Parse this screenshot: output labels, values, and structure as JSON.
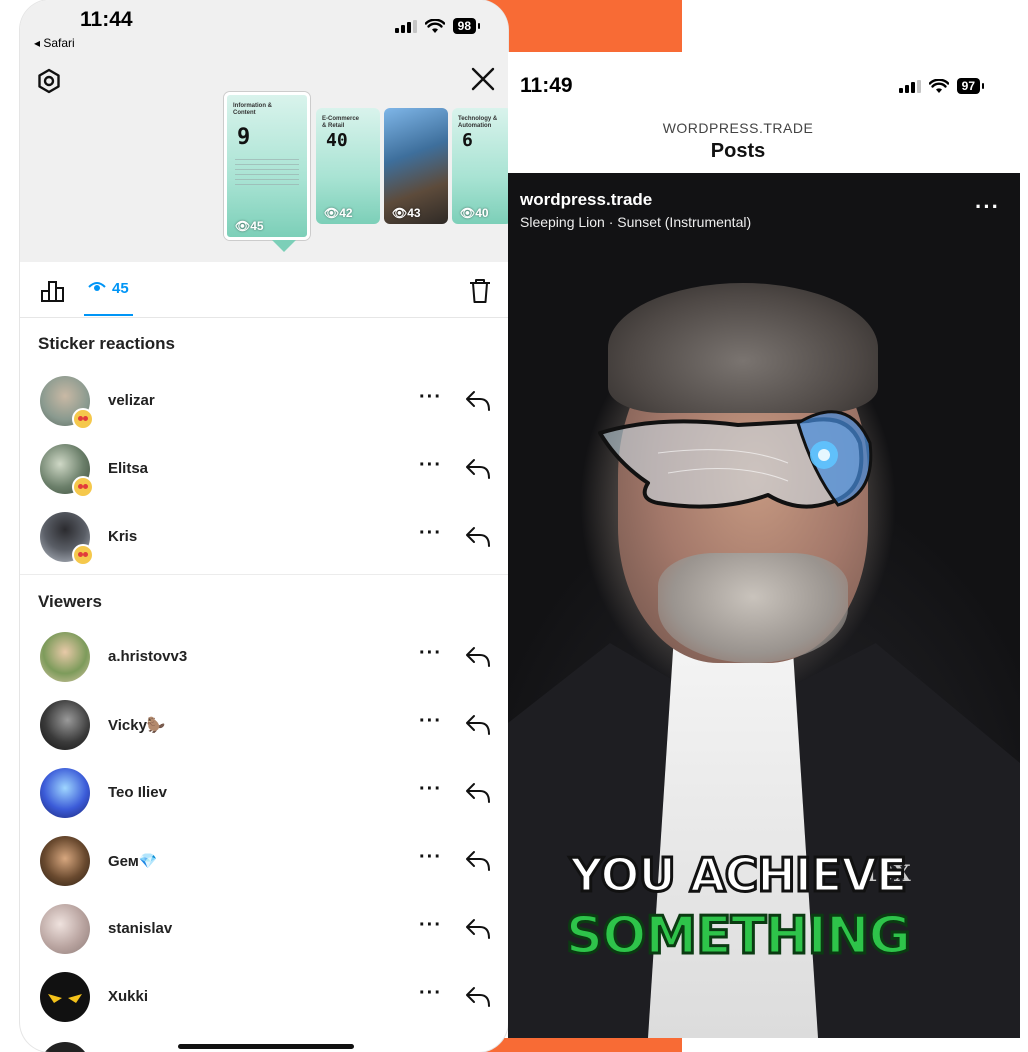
{
  "colors": {
    "accent_blue": "#0095f6",
    "orange": "#f86b35",
    "caption_green": "#2ec44a"
  },
  "left": {
    "status": {
      "time": "11:44",
      "back_app": "◂ Safari",
      "battery": "98"
    },
    "thumbnails": [
      {
        "title": "Information & Content",
        "number": "9",
        "views": "45",
        "selected": true
      },
      {
        "title": "E-Commerce & Retail",
        "number": "40",
        "views": "42"
      },
      {
        "title": "",
        "number": "",
        "views": "43",
        "photo": true
      },
      {
        "title": "Technology & Automation",
        "number": "6",
        "views": "40"
      }
    ],
    "tabs": {
      "views_count": "45"
    },
    "sticker_reactions": {
      "title": "Sticker reactions",
      "users": [
        {
          "name": "velizar",
          "avatar_color": "#8a9a8f"
        },
        {
          "name": "Elitsa",
          "avatar_color": "#6b7f6a"
        },
        {
          "name": "Kris",
          "avatar_color": "#5a5e66"
        }
      ]
    },
    "viewers": {
      "title": "Viewers",
      "users": [
        {
          "name": "a.hristovv3",
          "avatar_color": "#7d9b5b"
        },
        {
          "name": "Vicky🦫",
          "avatar_color": "#3a3a3a"
        },
        {
          "name": "Teo Iliev",
          "avatar_color": "#3b5bd8"
        },
        {
          "name": "Gем💎",
          "avatar_color": "#6a4a2f"
        },
        {
          "name": "stanislav",
          "avatar_color": "#b9a4a0"
        },
        {
          "name": "Xukki",
          "avatar_color": "#111111"
        }
      ]
    }
  },
  "right": {
    "status": {
      "time": "11:49",
      "battery": "97"
    },
    "header": {
      "account": "WORDPRESS.TRADE",
      "title": "Posts"
    },
    "video": {
      "username": "wordpress.trade",
      "audio": "Sleeping Lion · Sunset (Instrumental)",
      "caption_line1": "YOU ACHIEVE",
      "caption_line2": "SOMETHING",
      "pin_text": "10X"
    }
  }
}
